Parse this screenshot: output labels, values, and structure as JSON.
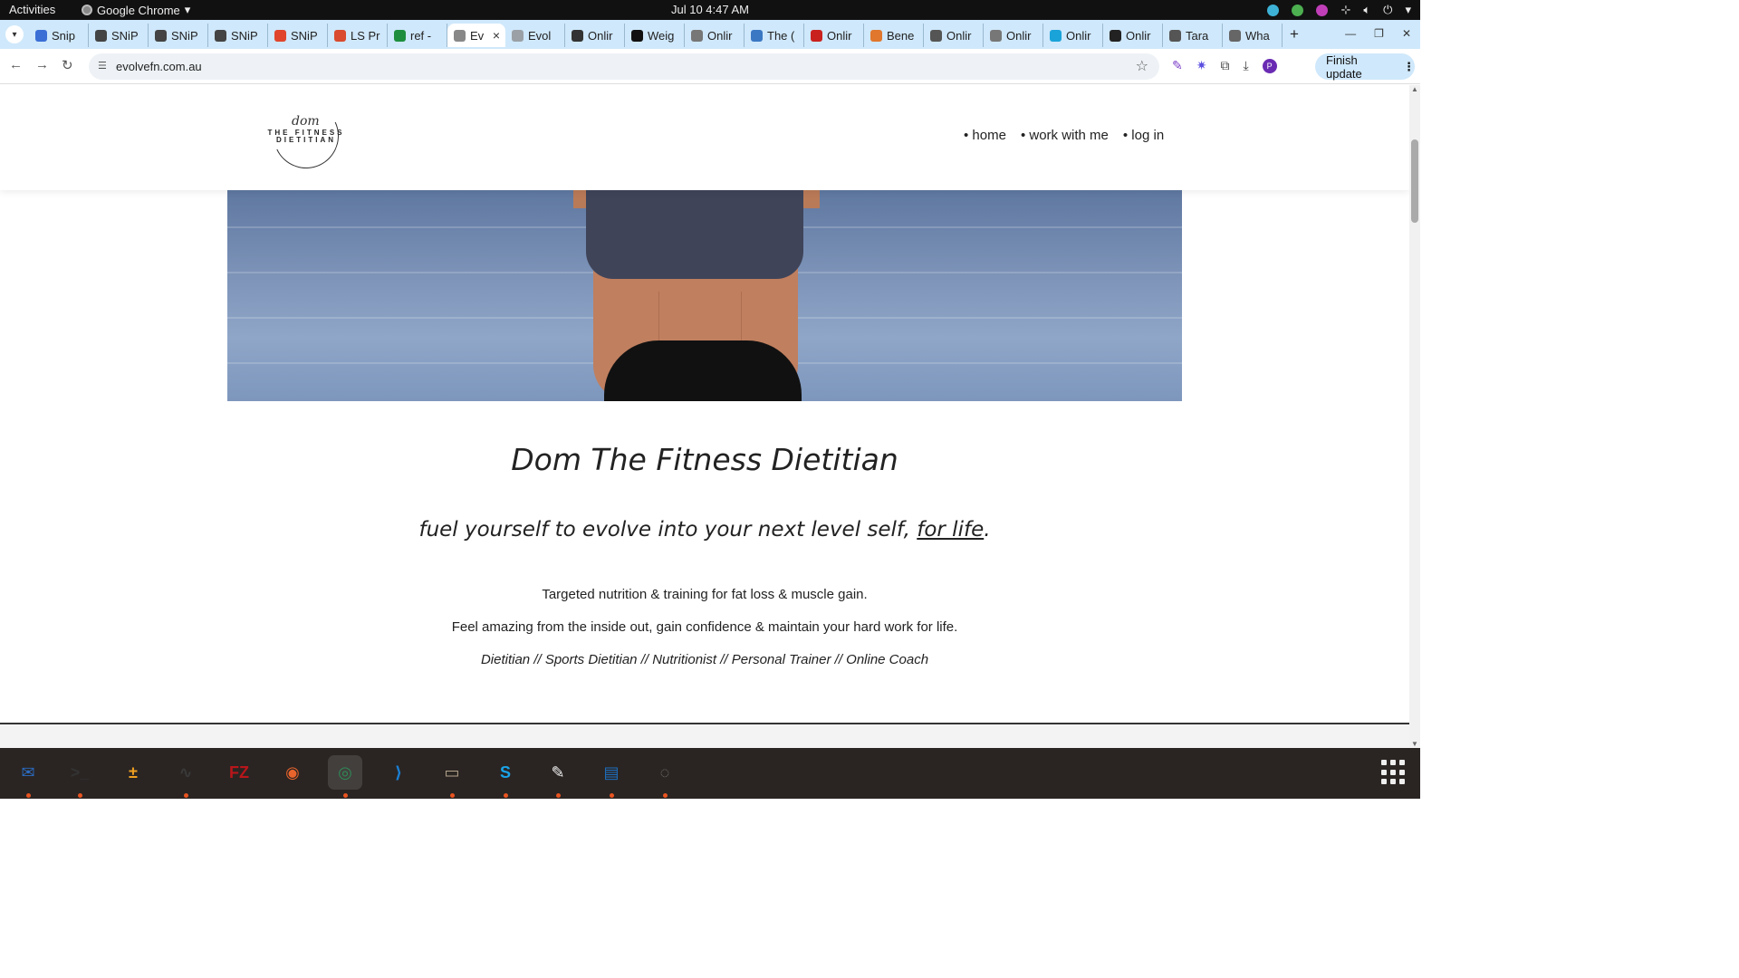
{
  "system": {
    "activities": "Activities",
    "app_name": "Google Chrome",
    "clock": "Jul 10  4:47 AM"
  },
  "browser": {
    "tabs": [
      {
        "label": "Snip",
        "color": "#3b6fd6"
      },
      {
        "label": "SNiP",
        "color": "#444444"
      },
      {
        "label": "SNiP",
        "color": "#444444"
      },
      {
        "label": "SNiP",
        "color": "#444444"
      },
      {
        "label": "SNiP",
        "color": "#e0452c"
      },
      {
        "label": "LS Pr",
        "color": "#d94a2e"
      },
      {
        "label": "ref -",
        "color": "#1e8e3e"
      },
      {
        "label": "Ev",
        "color": "#888888",
        "active": true
      },
      {
        "label": "Evol",
        "color": "#9aa0a6"
      },
      {
        "label": "Onlir",
        "color": "#333333"
      },
      {
        "label": "Weig",
        "color": "#111111"
      },
      {
        "label": "Onlir",
        "color": "#777777"
      },
      {
        "label": "The (",
        "color": "#3a78c3"
      },
      {
        "label": "Onlir",
        "color": "#c9211e"
      },
      {
        "label": "Bene",
        "color": "#e0772c"
      },
      {
        "label": "Onlir",
        "color": "#555555"
      },
      {
        "label": "Onlir",
        "color": "#777777"
      },
      {
        "label": "Onlir",
        "color": "#1aa3d9"
      },
      {
        "label": "Onlir",
        "color": "#222222"
      },
      {
        "label": "Tara",
        "color": "#555555"
      },
      {
        "label": "Wha",
        "color": "#666666"
      }
    ],
    "new_tab": "+",
    "url": "evolvefn.com.au",
    "finish_update": "Finish update",
    "profile_initial": "P"
  },
  "site": {
    "logo": {
      "script": "dom",
      "line1": "THE FITNESS",
      "line2": "DIETITIAN"
    },
    "menu": [
      {
        "label": "• home"
      },
      {
        "label": "• work with me"
      },
      {
        "label": "• log in"
      }
    ],
    "title": "Dom The Fitness Dietitian",
    "tagline_prefix": "fuel yourself to evolve into your next level self, ",
    "tagline_emphasis": "for life",
    "tagline_suffix": ".",
    "description_1": "Targeted nutrition & training for fat loss & muscle gain.",
    "description_2": "Feel amazing from the inside out, gain confidence & maintain your hard work for life.",
    "roles": "Dietitian // Sports Dietitian // Nutritionist // Personal Trainer // Online Coach"
  },
  "dock": {
    "apps": [
      {
        "name": "thunderbird",
        "glyph": "✉",
        "color": "#2b6cc4",
        "running": true
      },
      {
        "name": "terminal",
        "glyph": ">_",
        "color": "#333333",
        "running": true
      },
      {
        "name": "calculator",
        "glyph": "±",
        "color": "#f0a020",
        "running": false
      },
      {
        "name": "system-monitor",
        "glyph": "∿",
        "color": "#3a3a3a",
        "running": true
      },
      {
        "name": "filezilla",
        "glyph": "FZ",
        "color": "#b8161b",
        "running": false
      },
      {
        "name": "firefox",
        "glyph": "◉",
        "color": "#e8642c",
        "running": false
      },
      {
        "name": "chrome",
        "glyph": "◎",
        "color": "#2e8b57",
        "running": true
      },
      {
        "name": "vscode",
        "glyph": "⟩",
        "color": "#1a7fd4",
        "running": false
      },
      {
        "name": "files",
        "glyph": "▭",
        "color": "#b5a48c",
        "running": true
      },
      {
        "name": "skype",
        "glyph": "S",
        "color": "#1aa3e8",
        "running": true
      },
      {
        "name": "text-editor",
        "glyph": "✎",
        "color": "#f2f2f2",
        "running": true
      },
      {
        "name": "writer",
        "glyph": "▤",
        "color": "#1e6fbf",
        "running": true
      },
      {
        "name": "disks",
        "glyph": "◌",
        "color": "#777777",
        "running": true
      }
    ]
  }
}
